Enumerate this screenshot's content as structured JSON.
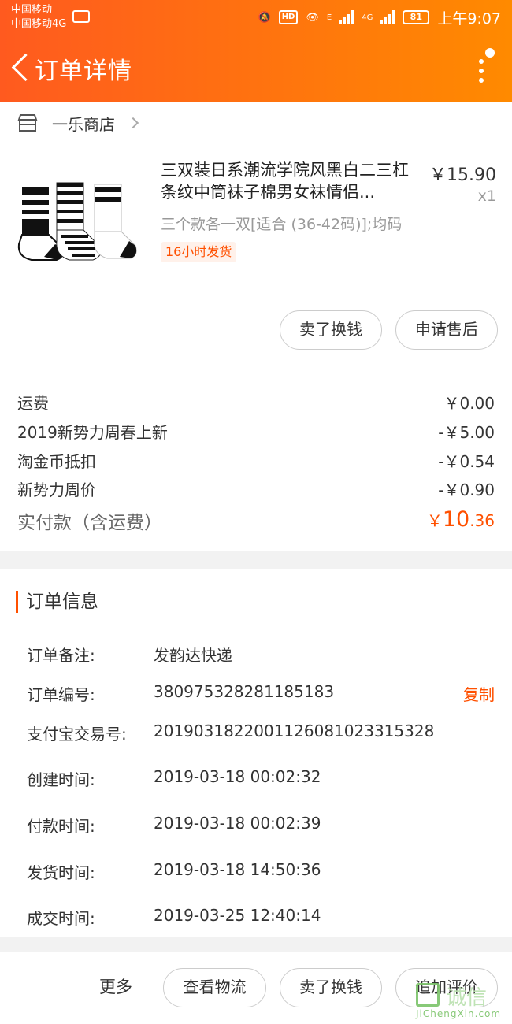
{
  "status_bar": {
    "carrier_1": "中国移动",
    "carrier_2": "中国移动4G",
    "hd": "HD",
    "network_1": "E",
    "network_2": "4G",
    "battery": "81",
    "time": "上午9:07"
  },
  "header": {
    "title": "订单详情"
  },
  "store": {
    "name": "一乐商店"
  },
  "item": {
    "title": "三双装日系潮流学院风黑白二三杠条纹中筒袜子棉男女袜情侣...",
    "price": "￥15.90",
    "qty": "x1",
    "spec": "三个款各一双[适合 (36-42码)];均码",
    "ship_tag": "16小时发货",
    "actions": [
      "卖了换钱",
      "申请售后"
    ]
  },
  "fees": [
    {
      "label": "运费",
      "value": "￥0.00"
    },
    {
      "label": "2019新势力周春上新",
      "value": "-￥5.00"
    },
    {
      "label": "淘金币抵扣",
      "value": "-￥0.54"
    },
    {
      "label": "新势力周价",
      "value": "-￥0.90"
    }
  ],
  "paid": {
    "label": "实付款（含运费）",
    "currency": "￥",
    "integer": "10",
    "decimal": ".36"
  },
  "order_info": {
    "heading": "订单信息",
    "rows": [
      {
        "label": "订单备注:",
        "value": "发韵达快递"
      },
      {
        "label": "订单编号:",
        "value": "380975328281185183"
      },
      {
        "label": "支付宝交易号:",
        "value": "2019031822001126081023315328"
      },
      {
        "label": "创建时间:",
        "value": "2019-03-18 00:02:32"
      },
      {
        "label": "付款时间:",
        "value": "2019-03-18 00:02:39"
      },
      {
        "label": "发货时间:",
        "value": "2019-03-18 14:50:36"
      },
      {
        "label": "成交时间:",
        "value": "2019-03-25 12:40:14"
      }
    ],
    "copy_label": "复制"
  },
  "bottom_bar": {
    "more": "更多",
    "buttons": [
      "查看物流",
      "卖了换钱",
      "追加评价"
    ]
  },
  "watermark": {
    "text": "诚信",
    "sub": "JiChengXin.com"
  },
  "colors": {
    "accent": "#ff5000",
    "header_start": "#ff5a1f",
    "header_end": "#ff8a00"
  }
}
